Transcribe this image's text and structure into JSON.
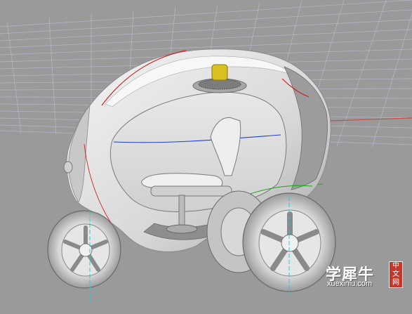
{
  "viewport": {
    "label": "3D modeling viewport",
    "background": "#9a9a9a",
    "grid_color": "#b4b4c4",
    "axis_x_color": "#c0504d",
    "axis_y_color": "#3a9a3a"
  },
  "model": {
    "body_color": "#e4e4e4",
    "shade_color": "#b8b8b8",
    "edge_red": "#cc2020",
    "edge_blue": "#2040cc",
    "edge_green": "#20a020",
    "edge_cyan": "#20d0d0",
    "roof_light_color": "#d8c020"
  },
  "watermark": {
    "text": "学犀牛",
    "url": "xuexiniu.com",
    "badge": "中文网"
  }
}
